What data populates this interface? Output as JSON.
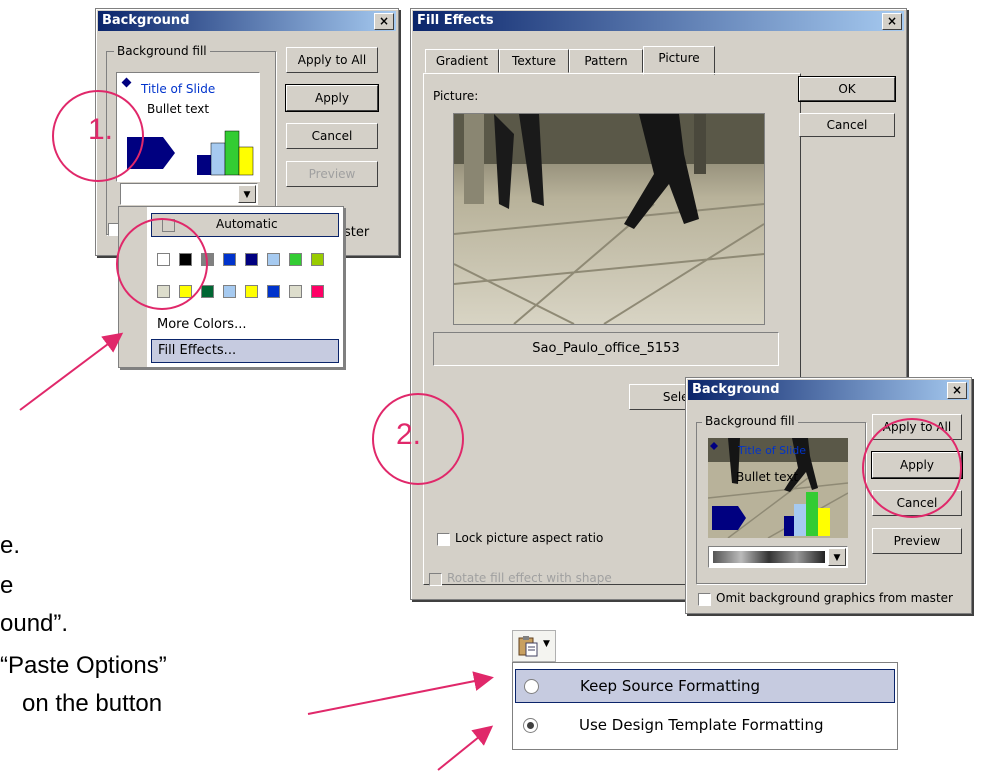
{
  "background_dialog_1": {
    "title": "Background",
    "group_label": "Background fill",
    "slide_title": "Title of Slide",
    "bullet_text": "Bullet text",
    "buttons": {
      "apply_all": "Apply to All",
      "apply": "Apply",
      "cancel": "Cancel",
      "preview": "Preview"
    },
    "master_partial": "ster"
  },
  "color_menu": {
    "automatic": "Automatic",
    "more_colors": "More Colors...",
    "fill_effects": "Fill Effects...",
    "row1_colors": [
      "#ffffff",
      "#000000",
      "#808080",
      "#0033cc",
      "#000080",
      "#a6caf0",
      "#33cc33",
      "#99cc00"
    ],
    "row2_colors": [
      "#ddddcc",
      "#ffff00",
      "#006633",
      "#a6caf0",
      "#ffff00",
      "#0033cc",
      "#ddddcc",
      "#ff0066"
    ]
  },
  "fill_effects_dialog": {
    "title": "Fill Effects",
    "tabs": [
      "Gradient",
      "Texture",
      "Pattern",
      "Picture"
    ],
    "picture_label": "Picture:",
    "picture_name": "Sao_Paulo_office_5153",
    "select_partial": "Selec",
    "lock_label": "Lock picture aspect ratio",
    "rotate_label": "Rotate fill effect with shape",
    "ok": "OK",
    "cancel": "Cancel"
  },
  "background_dialog_2": {
    "title": "Background",
    "group_label": "Background fill",
    "slide_title": "Title of Slide",
    "bullet_text": "Bullet text",
    "buttons": {
      "apply_all": "Apply to All",
      "apply": "Apply",
      "cancel": "Cancel",
      "preview": "Preview"
    },
    "omit_label": "Omit background graphics from master"
  },
  "annotations": {
    "step1": "1.",
    "step2": "2."
  },
  "slide_text": {
    "line1": "e.",
    "line2": "e",
    "line3": "ound”.",
    "line4": "“Paste Options”",
    "line5": "on the button"
  },
  "paste_options": {
    "keep_source": "Keep Source Formatting",
    "use_design": "Use Design Template Formatting"
  },
  "colors": {
    "accent": "#e0286a",
    "titlebar": "#0a246a",
    "dialog_bg": "#d4d0c8"
  }
}
